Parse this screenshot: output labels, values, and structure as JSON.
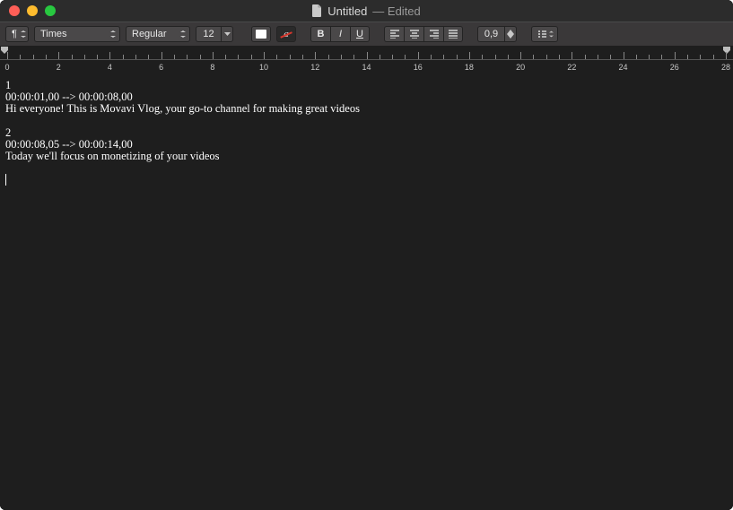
{
  "titlebar": {
    "filename": "Untitled",
    "status": "— Edited"
  },
  "toolbar": {
    "para_marker": "¶",
    "font_family": "Times",
    "font_style": "Regular",
    "font_size": "12",
    "text_color": "#ffffff",
    "highlight_off": "a",
    "bold": "B",
    "italic": "I",
    "underline": "U",
    "line_spacing": "0,9"
  },
  "ruler": {
    "labels": [
      "0",
      "2",
      "4",
      "6",
      "8",
      "10",
      "12",
      "14",
      "16",
      "18",
      "20",
      "22",
      "24",
      "26",
      "28"
    ]
  },
  "document": {
    "blocks": [
      {
        "index": "1",
        "timecode": "00:00:01,00 --> 00:00:08,00",
        "text": "Hi everyone! This is Movavi Vlog, your go-to channel for making great videos"
      },
      {
        "index": "2",
        "timecode": "00:00:08,05 --> 00:00:14,00",
        "text": "Today we'll focus on monetizing of your videos"
      }
    ]
  }
}
